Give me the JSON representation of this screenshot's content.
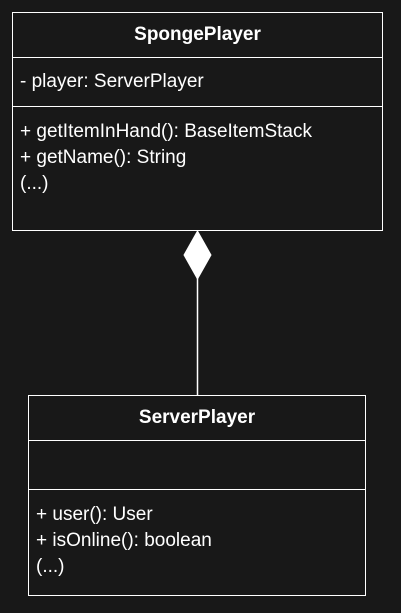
{
  "classes": {
    "sponge_player": {
      "name": "SpongePlayer",
      "attributes": [
        "- player: ServerPlayer"
      ],
      "methods": [
        "+ getItemInHand(): BaseItemStack",
        "+ getName(): String",
        "(...)"
      ]
    },
    "server_player": {
      "name": "ServerPlayer",
      "attributes": [],
      "methods": [
        "+ user(): User",
        "+ isOnline(): boolean",
        "(...)"
      ]
    }
  },
  "relationship": {
    "type": "composition",
    "whole": "SpongePlayer",
    "part": "ServerPlayer"
  },
  "colors": {
    "background": "#181818",
    "stroke": "#ffffff",
    "text": "#ffffff"
  }
}
